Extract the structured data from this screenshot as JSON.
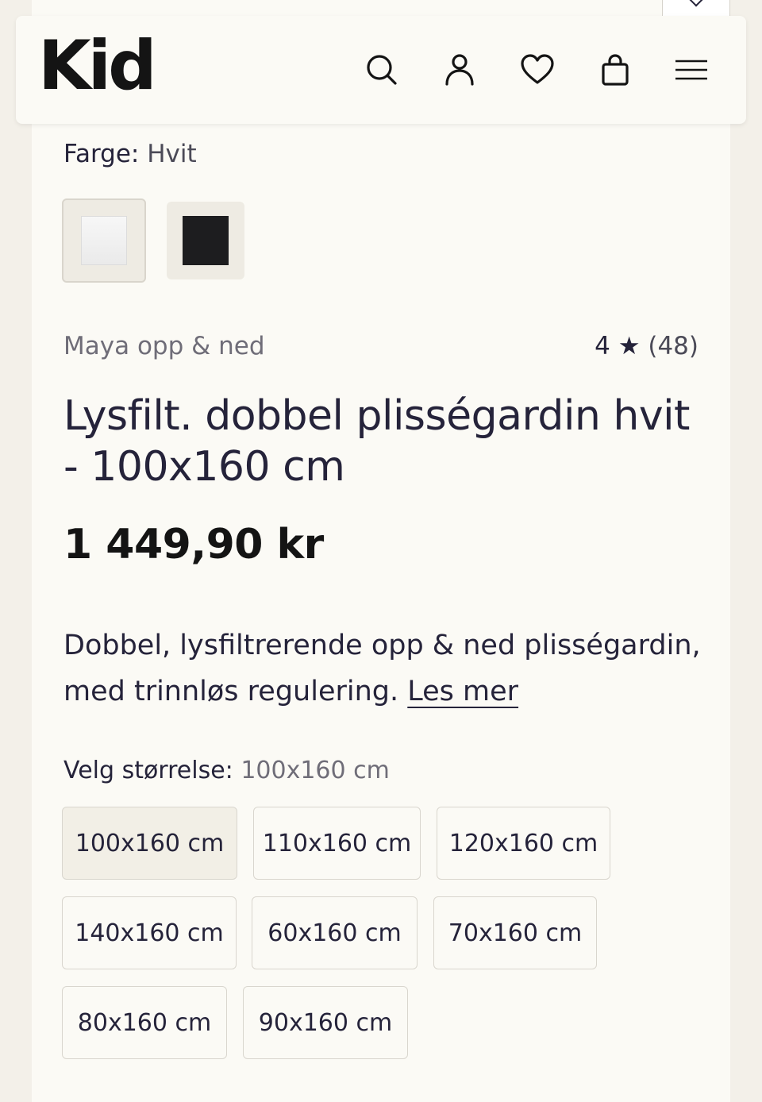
{
  "header": {
    "logo": "Kid"
  },
  "product": {
    "color_label": "Farge:",
    "color_value": "Hvit",
    "swatches": [
      {
        "name": "Hvit",
        "color": "#f4f4f4"
      },
      {
        "name": "Svart",
        "color": "#1d1d1f"
      }
    ],
    "brand": "Maya opp & ned",
    "rating_value": "4",
    "rating_star": "★",
    "rating_count": "(48)",
    "title": "Lysfilt. dobbel plisségardin hvit - 100x160 cm",
    "price": "1 449,90 kr",
    "description": "Dobbel, lysfiltrerende opp & ned plisségardin, med trinnløs regulering.",
    "read_more": "Les mer",
    "size_label": "Velg størrelse:",
    "size_value": "100x160 cm",
    "sizes": [
      "100x160 cm",
      "110x160 cm",
      "120x160 cm",
      "140x160 cm",
      "60x160 cm",
      "70x160 cm",
      "80x160 cm",
      "90x160 cm"
    ],
    "selected_size": "100x160 cm"
  },
  "colors": {
    "text": "#25233a",
    "background": "#fbfaf5",
    "page": "#f3f0e9"
  },
  "icons": [
    "search-icon",
    "user-icon",
    "heart-icon",
    "bag-icon",
    "menu-icon",
    "chevron-down-icon"
  ]
}
